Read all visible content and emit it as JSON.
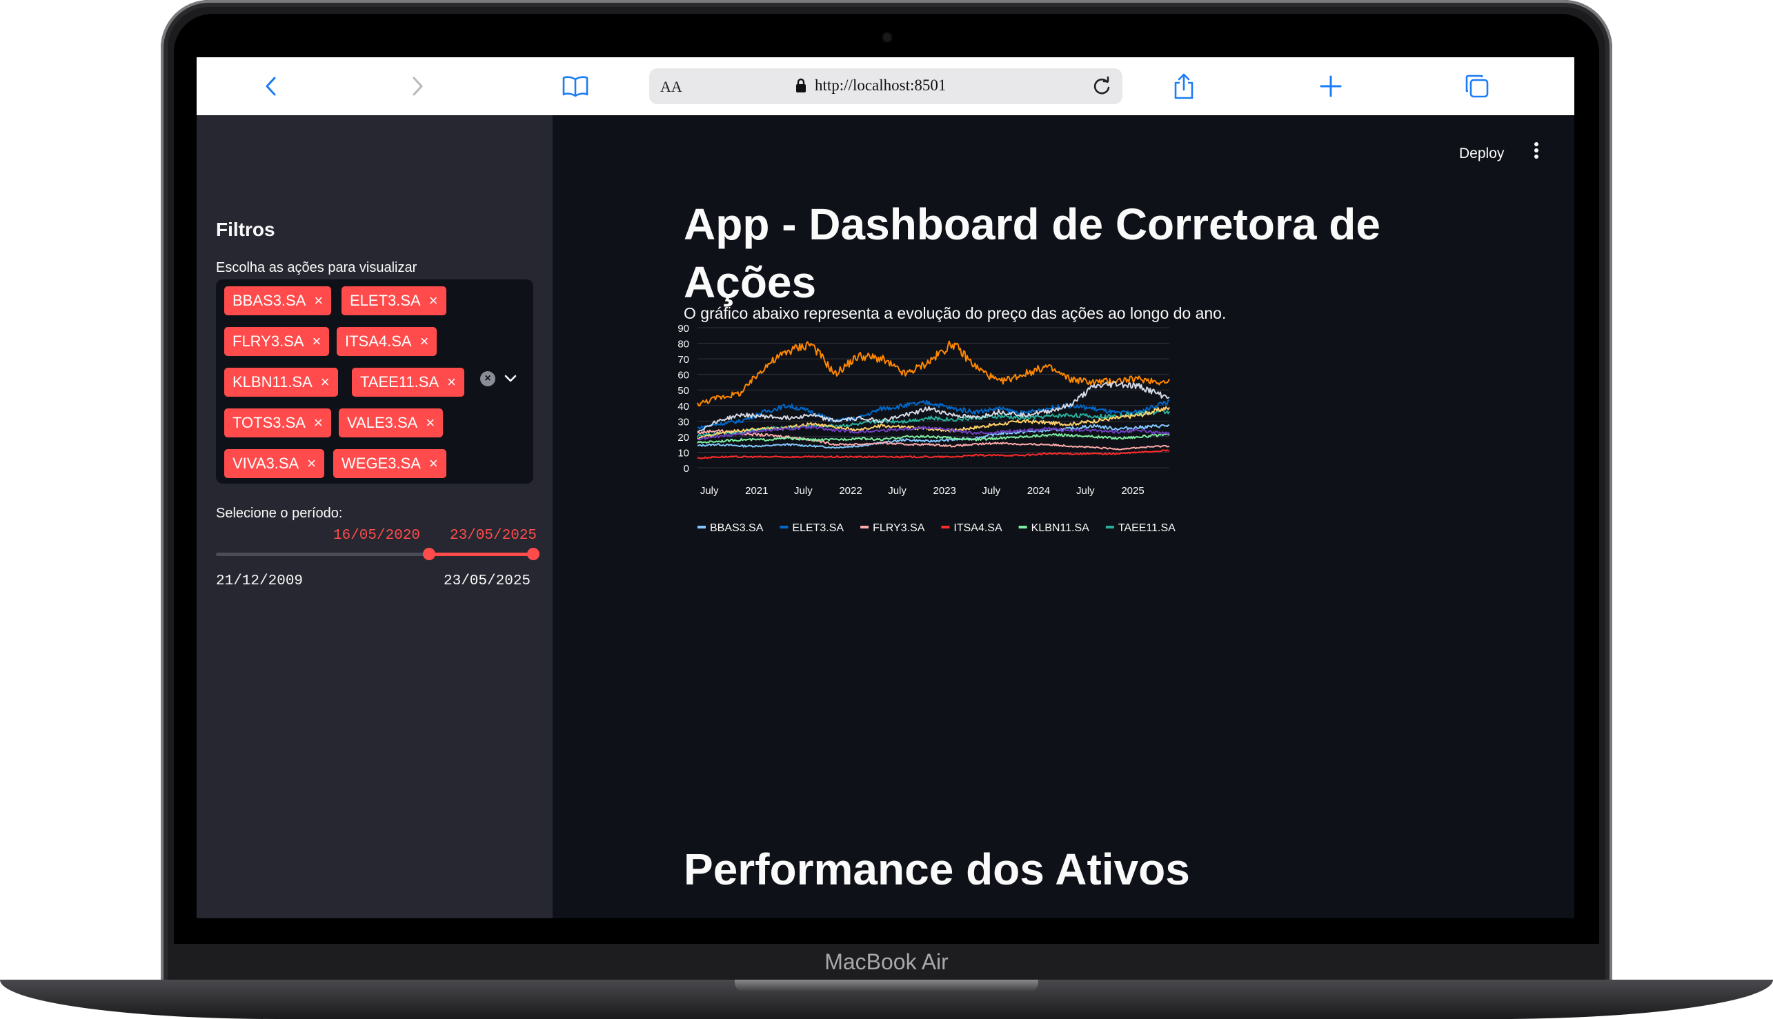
{
  "device": {
    "label": "MacBook Air"
  },
  "browser": {
    "text_size_button": "AA",
    "url": "http://localhost:8501"
  },
  "sidebar": {
    "title": "Filtros",
    "stocks_label": "Escolha as ações para visualizar",
    "selected_stocks": [
      "BBAS3.SA",
      "ELET3.SA",
      "FLRY3.SA",
      "ITSA4.SA",
      "KLBN11.SA",
      "TAEE11.SA",
      "TOTS3.SA",
      "VALE3.SA",
      "VIVA3.SA",
      "WEGE3.SA"
    ],
    "period_label": "Selecione o período:",
    "period_start": "16/05/2020",
    "period_end": "23/05/2025",
    "range_min": "21/12/2009",
    "range_max": "23/05/2025",
    "remove_glyph": "×"
  },
  "header": {
    "deploy_label": "Deploy"
  },
  "main": {
    "title": "App - Dashboard de Corretora de Ações",
    "description": "O gráfico abaixo representa a evolução do preço das ações ao longo do ano.",
    "section_title": "Performance dos Ativos"
  },
  "colors": {
    "accent": "#ff4b4b",
    "background": "#0e1117",
    "sidebar": "#262730",
    "browser_blue": "#1b7cf5"
  },
  "chart_data": {
    "type": "line",
    "title": "",
    "xlabel": "",
    "ylabel": "",
    "ylim": [
      0,
      90
    ],
    "yticks": [
      0,
      10,
      20,
      30,
      40,
      50,
      60,
      70,
      80,
      90
    ],
    "x_tick_labels": [
      "July",
      "2021",
      "July",
      "2022",
      "July",
      "2023",
      "July",
      "2024",
      "July",
      "2025"
    ],
    "x_ticks": [
      "2020-07",
      "2021-01",
      "2021-07",
      "2022-01",
      "2022-07",
      "2023-01",
      "2023-07",
      "2024-01",
      "2024-07",
      "2025-01"
    ],
    "x_range": [
      "2020-05-16",
      "2025-05-23"
    ],
    "grid": true,
    "legend_position": "bottom",
    "x": [
      "2020-05",
      "2020-08",
      "2020-11",
      "2021-02",
      "2021-05",
      "2021-08",
      "2021-11",
      "2022-02",
      "2022-05",
      "2022-08",
      "2022-11",
      "2023-02",
      "2023-05",
      "2023-08",
      "2023-11",
      "2024-02",
      "2024-05",
      "2024-08",
      "2024-11",
      "2025-02",
      "2025-05"
    ],
    "series": [
      {
        "name": "BBAS3.SA",
        "color": "#83c9ff",
        "values": [
          14,
          15,
          14,
          14,
          15,
          14,
          13,
          14,
          16,
          18,
          17,
          18,
          19,
          22,
          23,
          24,
          25,
          27,
          25,
          26,
          27
        ]
      },
      {
        "name": "ELET3.SA",
        "color": "#0068c9",
        "values": [
          25,
          28,
          30,
          36,
          40,
          36,
          30,
          32,
          38,
          40,
          42,
          38,
          36,
          38,
          35,
          38,
          40,
          38,
          35,
          36,
          42
        ]
      },
      {
        "name": "FLRY3.SA",
        "color": "#ffabab",
        "values": [
          22,
          24,
          22,
          21,
          20,
          18,
          15,
          15,
          16,
          15,
          15,
          14,
          15,
          16,
          15,
          15,
          14,
          13,
          12,
          13,
          14
        ]
      },
      {
        "name": "ITSA4.SA",
        "color": "#ff2b2b",
        "values": [
          6,
          7,
          7,
          7,
          7,
          7,
          7,
          7,
          7,
          7,
          7,
          7,
          8,
          8,
          8,
          9,
          9,
          9,
          9,
          10,
          11
        ]
      },
      {
        "name": "KLBN11.SA",
        "color": "#7defa1",
        "values": [
          16,
          17,
          18,
          18,
          19,
          18,
          18,
          19,
          18,
          20,
          20,
          19,
          18,
          19,
          20,
          21,
          21,
          20,
          19,
          20,
          21
        ]
      },
      {
        "name": "TAEE11.SA",
        "color": "#29b09d",
        "values": [
          20,
          22,
          23,
          25,
          26,
          27,
          27,
          28,
          30,
          30,
          32,
          31,
          32,
          33,
          32,
          33,
          34,
          33,
          33,
          35,
          36
        ]
      },
      {
        "name": "TOTS3.SA",
        "color": "#ffd16a",
        "values": [
          18,
          22,
          24,
          25,
          26,
          28,
          26,
          24,
          27,
          26,
          25,
          24,
          26,
          28,
          30,
          29,
          28,
          30,
          32,
          34,
          38
        ]
      },
      {
        "name": "VALE3.SA",
        "color": "#ff8700",
        "values": [
          40,
          45,
          48,
          65,
          75,
          80,
          60,
          72,
          70,
          60,
          68,
          80,
          65,
          55,
          60,
          65,
          57,
          55,
          56,
          57,
          55
        ]
      },
      {
        "name": "VIVA3.SA",
        "color": "#6d3fc0",
        "values": [
          18,
          20,
          22,
          24,
          25,
          26,
          24,
          23,
          24,
          25,
          26,
          24,
          22,
          23,
          24,
          25,
          24,
          24,
          23,
          24,
          22
        ]
      },
      {
        "name": "WEGE3.SA",
        "color": "#d5dae5",
        "values": [
          22,
          30,
          34,
          33,
          32,
          34,
          30,
          32,
          30,
          34,
          38,
          34,
          32,
          36,
          34,
          36,
          40,
          52,
          54,
          52,
          46
        ]
      }
    ]
  }
}
